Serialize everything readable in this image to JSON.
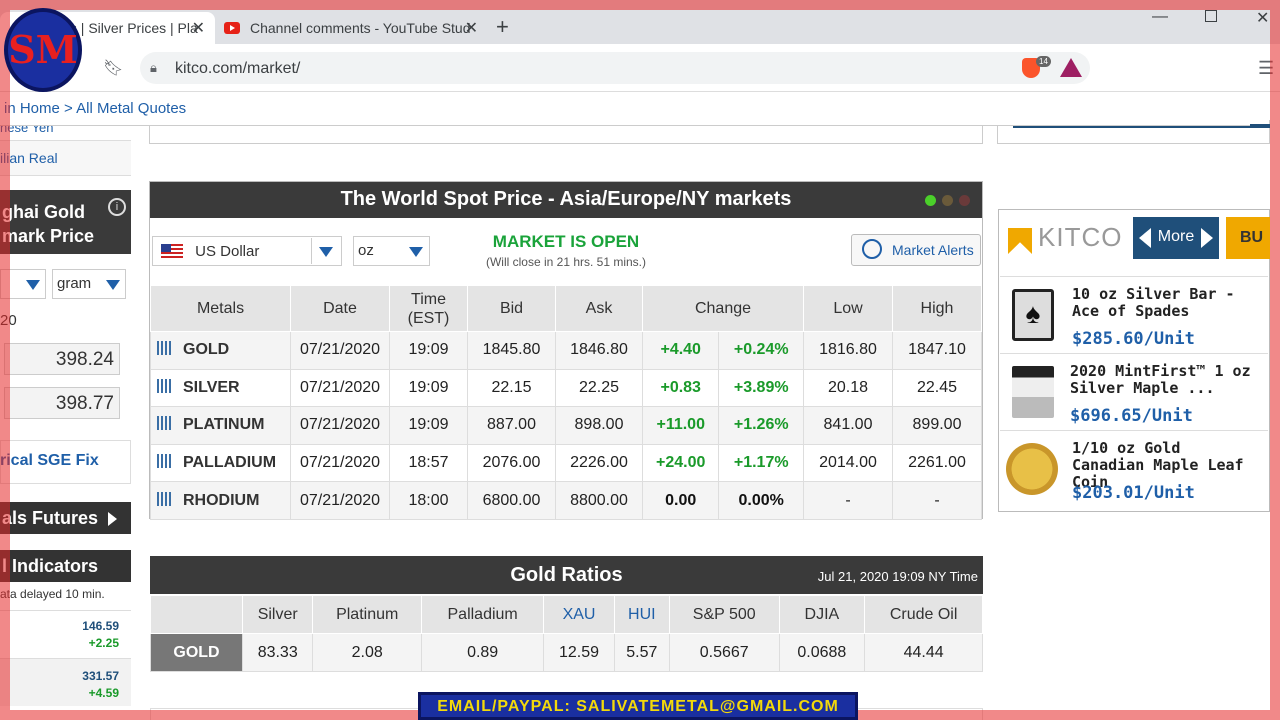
{
  "browser": {
    "tab1_title": "ices | Silver Prices | Pla",
    "tab2_title": "Channel comments - YouTube Stud",
    "url": "kitco.com/market/",
    "brave_badge": "14"
  },
  "breadcrumb": "in Home > All Metal Quotes",
  "sidebar": {
    "currency_items": [
      "nese Yen",
      "ilian Real"
    ],
    "sge_title_line1": "ghai Gold",
    "sge_title_line2": "mark Price",
    "unit_select": "gram",
    "date_fragment": "20",
    "value_am": "398.24",
    "value_pm": "398.77",
    "historical_link": "rical SGE Fix",
    "futures_label": "als Futures",
    "indicators_label": "l Indicators",
    "delay_note": "ata delayed 10 min.",
    "ind_rows": [
      {
        "value": "146.59",
        "change": "+2.25"
      },
      {
        "value": "331.57",
        "change": "+4.59"
      }
    ]
  },
  "spot": {
    "title": "The World Spot Price - Asia/Europe/NY markets",
    "currency": "US Dollar",
    "unit": "oz",
    "market_status": "MARKET IS OPEN",
    "market_close": "(Will close in 21 hrs. 51 mins.)",
    "alerts_label": "Market Alerts",
    "headers": {
      "metals": "Metals",
      "date": "Date",
      "time1": "Time",
      "time2": "(EST)",
      "bid": "Bid",
      "ask": "Ask",
      "change": "Change",
      "low": "Low",
      "high": "High"
    },
    "rows": [
      {
        "name": "GOLD",
        "date": "07/21/2020",
        "time": "19:09",
        "bid": "1845.80",
        "ask": "1846.80",
        "chg": "+4.40",
        "pct": "+0.24%",
        "low": "1816.80",
        "high": "1847.10"
      },
      {
        "name": "SILVER",
        "date": "07/21/2020",
        "time": "19:09",
        "bid": "22.15",
        "ask": "22.25",
        "chg": "+0.83",
        "pct": "+3.89%",
        "low": "20.18",
        "high": "22.45"
      },
      {
        "name": "PLATINUM",
        "date": "07/21/2020",
        "time": "19:09",
        "bid": "887.00",
        "ask": "898.00",
        "chg": "+11.00",
        "pct": "+1.26%",
        "low": "841.00",
        "high": "899.00"
      },
      {
        "name": "PALLADIUM",
        "date": "07/21/2020",
        "time": "18:57",
        "bid": "2076.00",
        "ask": "2226.00",
        "chg": "+24.00",
        "pct": "+1.17%",
        "low": "2014.00",
        "high": "2261.00"
      },
      {
        "name": "RHODIUM",
        "date": "07/21/2020",
        "time": "18:00",
        "bid": "6800.00",
        "ask": "8800.00",
        "chg": "0.00",
        "pct": "0.00%",
        "low": "-",
        "high": "-"
      }
    ]
  },
  "ratios": {
    "title": "Gold Ratios",
    "date": "Jul 21, 2020 19:09 NY Time",
    "headers": [
      "Silver",
      "Platinum",
      "Palladium",
      "XAU",
      "HUI",
      "S&P 500",
      "DJIA",
      "Crude Oil"
    ],
    "row_label": "GOLD",
    "values": [
      "83.33",
      "2.08",
      "0.89",
      "12.59",
      "5.57",
      "0.5667",
      "0.0688",
      "44.44"
    ]
  },
  "ad": {
    "logo": "KITCO",
    "more": "More",
    "buy": "BU",
    "products": [
      {
        "name": "10 oz Silver Bar - Ace of Spades",
        "price": "$285.60/Unit"
      },
      {
        "name": "2020 MintFirst™ 1 oz Silver Maple ...",
        "price": "$696.65/Unit"
      },
      {
        "name": "1/10 oz Gold Canadian Maple Leaf Coin",
        "price": "$203.01/Unit"
      }
    ]
  },
  "overlay": {
    "logo_text": "SM",
    "banner": "EMAIL/PAYPAL: SALIVATEMETAL@GMAIL.COM"
  },
  "colors": {
    "positive": "#1a9a2a",
    "link": "#1f5fa8",
    "header_dark": "#3a3a3a",
    "frame_red": "#e62828"
  }
}
